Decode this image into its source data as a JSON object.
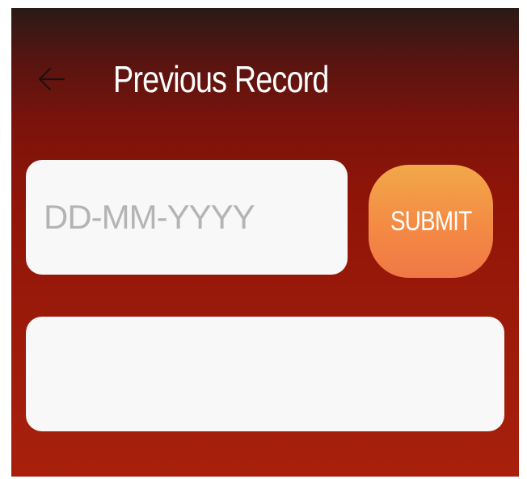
{
  "header": {
    "title": "Previous Record",
    "back_icon": "arrow-left-icon"
  },
  "form": {
    "date_placeholder": "DD-MM-YYYY",
    "date_value": "",
    "submit_label": "SUBMIT"
  },
  "result": {
    "text": ""
  },
  "colors": {
    "background_top": "#2a1a16",
    "background_main": "#9a1a0a",
    "field_background": "#f8f8f8",
    "button_top": "#f2a84a",
    "button_bottom": "#f07846",
    "title_text": "#ffffff"
  }
}
